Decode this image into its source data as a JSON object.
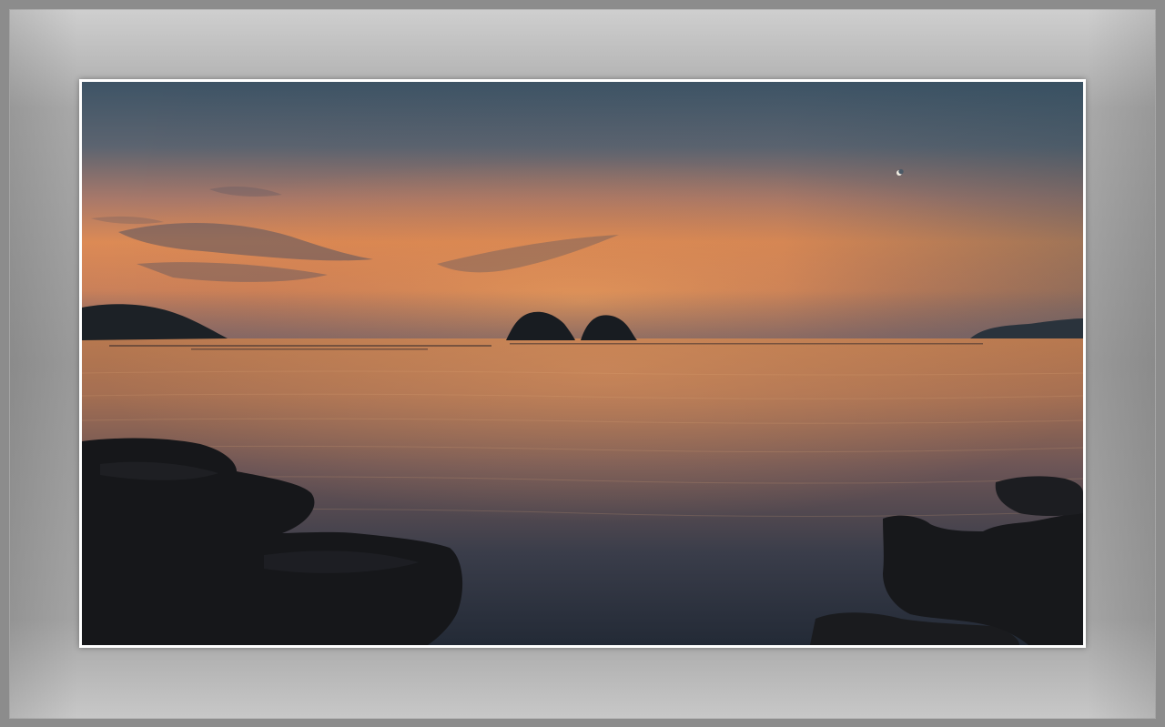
{
  "scene": {
    "description_tags": [
      "sunset",
      "sea",
      "islets",
      "rocks",
      "crescent-moon"
    ],
    "colors": {
      "sky_top": "#3f5566",
      "sky_mid": "#7d6e70",
      "sky_glow": "#e38a4a",
      "horizon": "#c77a50",
      "water_near": "#2a3140",
      "water_far": "#b5764f",
      "rock": "#141518",
      "frame_mat": "#a6a6a6"
    }
  }
}
